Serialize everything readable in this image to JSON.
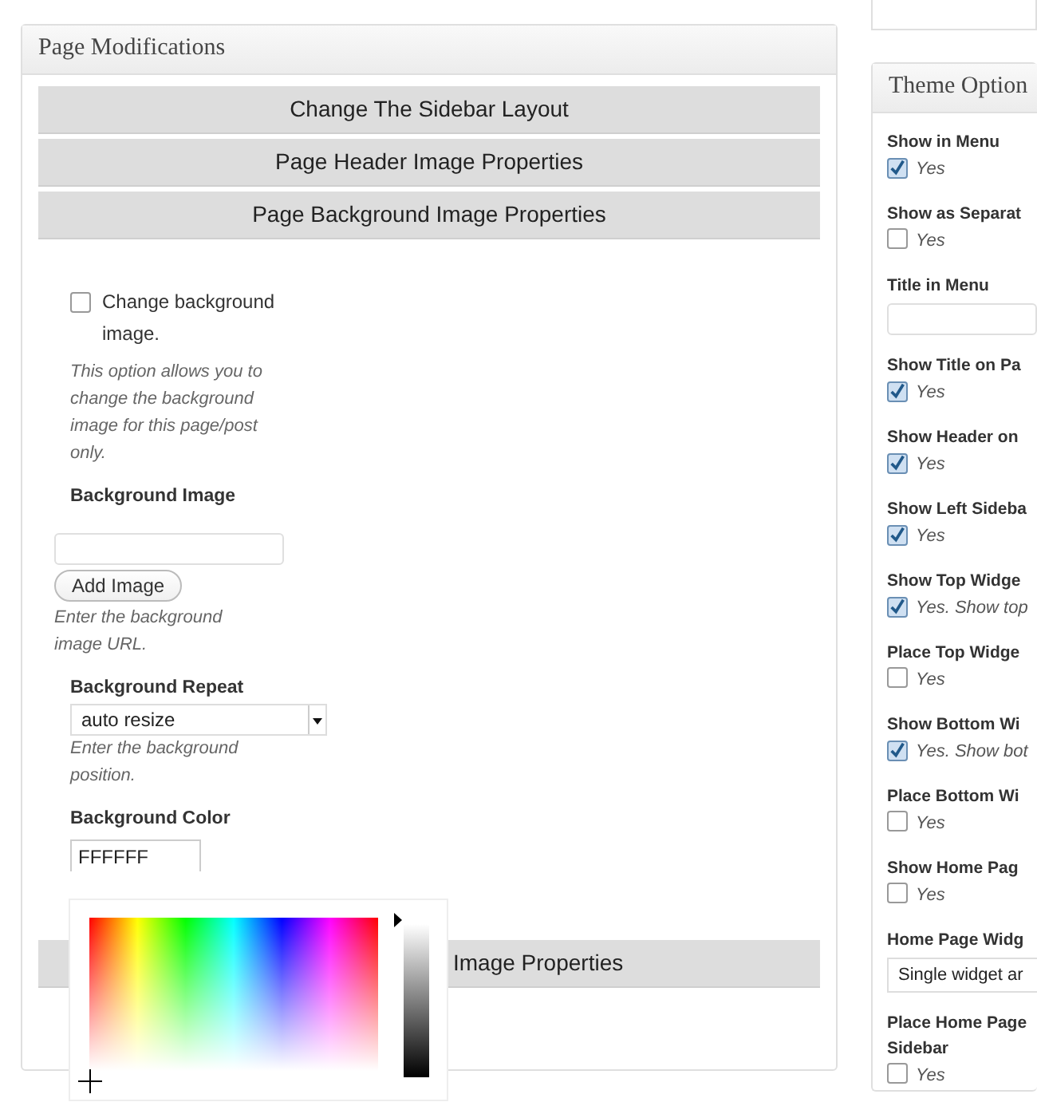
{
  "page_modifications": {
    "title": "Page Modifications",
    "sections": [
      {
        "label": "Change The Sidebar Layout"
      },
      {
        "label": "Page Header Image Properties"
      },
      {
        "label": "Page Background Image Properties"
      }
    ],
    "checkbox": {
      "label": "Change background image.",
      "checked": false
    },
    "checkbox_help": "This option allows you to change the background image for this page/post only.",
    "image_label": "Background Image",
    "image_button": "Add Image",
    "image_help": "Enter the background image URL.",
    "repeat_label": "Background Repeat",
    "repeat_value": "auto resize",
    "repeat_help": "Enter the background position.",
    "color_label": "Background Color",
    "color_value": "FFFFFF",
    "covered_section": {
      "label": "Image Properties"
    },
    "color_picker": {
      "brightness": {
        "level": 1
      }
    }
  },
  "theme_options": {
    "title": "Theme Option",
    "items": [
      {
        "kind": "checkbox",
        "label": "Show in Menu",
        "option": "Yes",
        "checked": true
      },
      {
        "kind": "checkbox",
        "label": "Show as Separat",
        "option": "Yes",
        "checked": false
      },
      {
        "kind": "text",
        "label": "Title in Menu"
      },
      {
        "kind": "checkbox",
        "label": "Show Title on Pa",
        "option": "Yes",
        "checked": true
      },
      {
        "kind": "checkbox",
        "label": "Show Header on",
        "option": "Yes",
        "checked": true
      },
      {
        "kind": "checkbox",
        "label": "Show Left Sideba",
        "option": "Yes",
        "checked": true
      },
      {
        "kind": "checkbox",
        "label": "Show Top Widge",
        "option": "Yes. Show top",
        "checked": true
      },
      {
        "kind": "checkbox",
        "label": "Place Top Widge",
        "option": "Yes",
        "checked": false
      },
      {
        "kind": "checkbox",
        "label": "Show Bottom Wi",
        "option": "Yes. Show bot",
        "checked": true
      },
      {
        "kind": "checkbox",
        "label": "Place Bottom Wi",
        "option": "Yes",
        "checked": false
      },
      {
        "kind": "checkbox",
        "label": "Show Home Pag",
        "option": "Yes",
        "checked": false
      },
      {
        "kind": "select",
        "label": "Home Page Widg",
        "value": "Single widget ar"
      },
      {
        "kind": "checkbox",
        "label": "Place Home Page Sidebar",
        "option": "Yes",
        "checked": false
      }
    ]
  }
}
